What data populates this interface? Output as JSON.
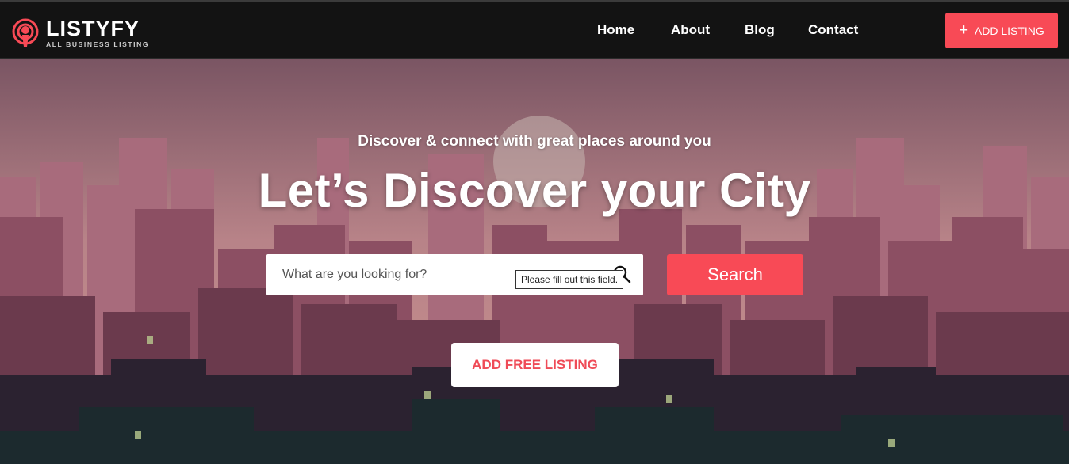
{
  "brand": {
    "name": "LISTYFY",
    "tagline": "ALL BUSINESS LISTING",
    "accent": "#f84a56"
  },
  "nav": {
    "links": [
      "Home",
      "About",
      "Blog",
      "Contact"
    ],
    "add_listing_label": "ADD LISTING",
    "add_listing_icon": "plus-icon"
  },
  "hero": {
    "subtitle": "Discover & connect with great places around you",
    "title": "Let’s Discover your City",
    "background": "pixel-art-city-skyline"
  },
  "search": {
    "placeholder": "What are you looking for?",
    "value": "",
    "icon": "search-icon",
    "validation_tooltip": "Please fill out this field.",
    "button_label": "Search"
  },
  "cta": {
    "free_listing_label": "ADD FREE LISTING"
  }
}
